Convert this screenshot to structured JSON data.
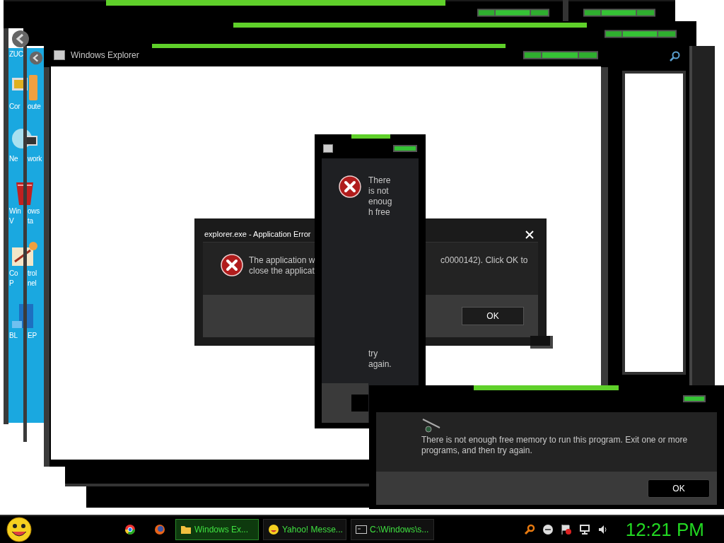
{
  "desktop_icons": [
    {
      "kind": "cut-off",
      "lines": [
        [
          "ZUC"
        ]
      ]
    },
    {
      "kind": "computer",
      "lines": [
        [
          "Cor",
          "oute"
        ]
      ]
    },
    {
      "kind": "network",
      "lines": [
        [
          "Ne",
          "work"
        ]
      ]
    },
    {
      "kind": "recycle-bin",
      "lines": [
        [
          "Win",
          "ows"
        ],
        [
          "V",
          "ta"
        ]
      ]
    },
    {
      "kind": "control-panel",
      "lines": [
        [
          "Co",
          "trol"
        ],
        [
          "P",
          "nel"
        ]
      ]
    },
    {
      "kind": "book",
      "lines": [
        [
          "BL",
          "EP"
        ]
      ]
    }
  ],
  "explorer_window": {
    "title": "Windows Explorer"
  },
  "app_error_dialog": {
    "title": "explorer.exe - Application Error",
    "message_left": [
      "The application w",
      "close the applicat"
    ],
    "message_right": "c0000142). Click OK to",
    "button": "OK"
  },
  "narrow_dialog": {
    "message_top": [
      "There",
      "is not",
      "enoug",
      "h free"
    ],
    "message_bottom": [
      "try",
      "again."
    ]
  },
  "memory_dialog": {
    "message": "There is not enough free memory to run this program. Exit one or more programs, and then try again.",
    "button": "OK"
  },
  "taskbar": {
    "quick_launch": [
      {
        "kind": "chrome"
      },
      {
        "kind": "firefox"
      }
    ],
    "tasks": [
      {
        "label": "Windows Ex...",
        "kind": "folder",
        "selected": true
      },
      {
        "label": "Yahoo! Messe...",
        "kind": "smiley",
        "selected": false
      },
      {
        "label": "C:\\Windows\\s...",
        "kind": "console",
        "selected": false
      }
    ],
    "tray": [
      {
        "kind": "search"
      },
      {
        "kind": "status"
      },
      {
        "kind": "flag"
      },
      {
        "kind": "network"
      },
      {
        "kind": "volume"
      }
    ],
    "clock": "12:21 PM"
  }
}
